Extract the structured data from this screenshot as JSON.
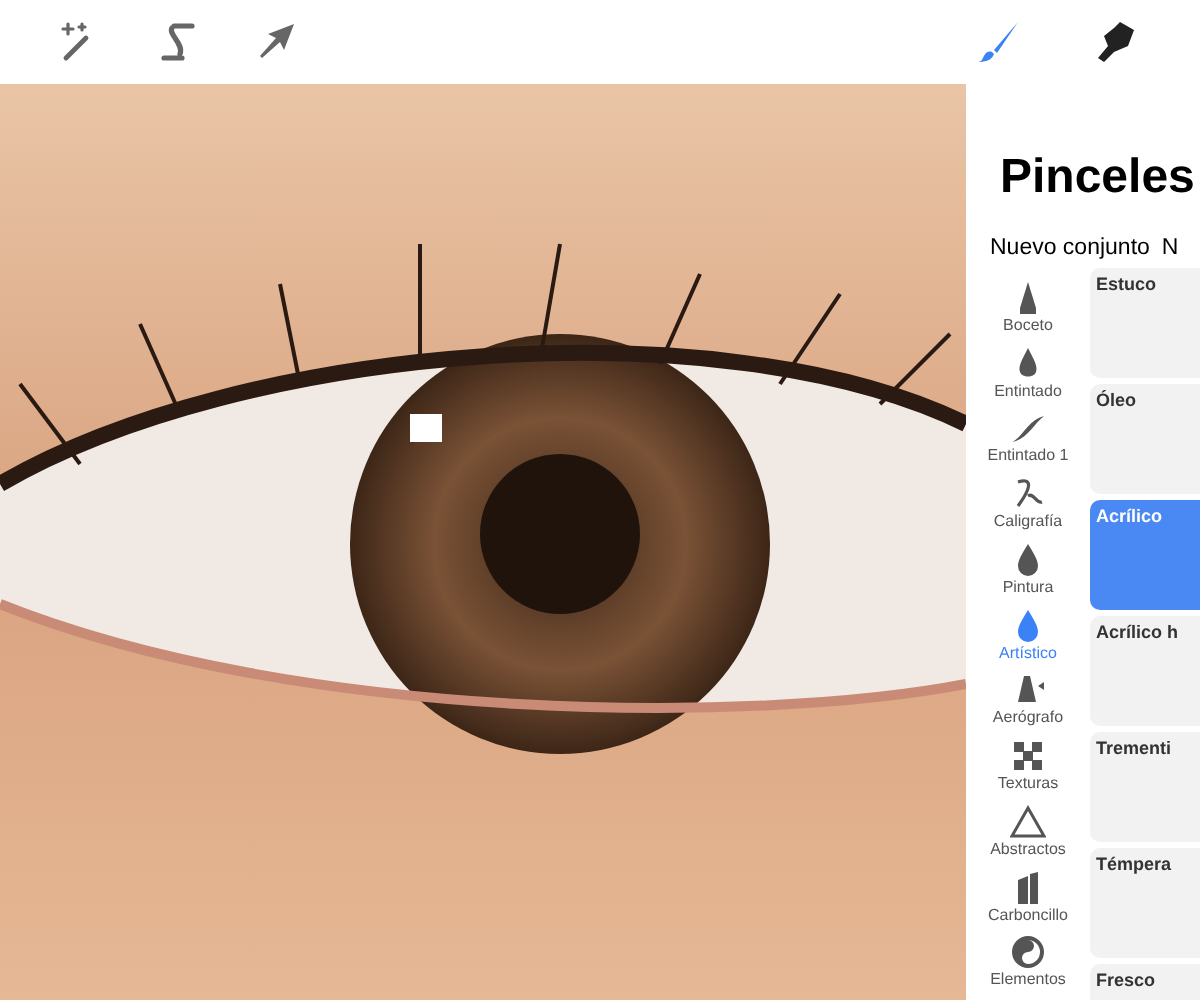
{
  "toolbar": {
    "tools": [
      {
        "kind": "wand",
        "selected": false
      },
      {
        "kind": "selection",
        "selected": false
      },
      {
        "kind": "transform",
        "selected": false
      }
    ],
    "right_tools": [
      {
        "kind": "brush",
        "selected": true
      },
      {
        "kind": "smudge",
        "selected": false
      }
    ]
  },
  "panel": {
    "title": "Pinceles",
    "actions": [
      "Nuevo conjunto",
      "N"
    ],
    "categories": [
      {
        "label": "Boceto",
        "kind": "cone",
        "selected": false
      },
      {
        "label": "Entintado",
        "kind": "nib",
        "selected": false
      },
      {
        "label": "Entintado 1",
        "kind": "stroke",
        "selected": false
      },
      {
        "label": "Caligrafía",
        "kind": "script",
        "selected": false
      },
      {
        "label": "Pintura",
        "kind": "drop",
        "selected": false
      },
      {
        "label": "Artístico",
        "kind": "drop",
        "selected": true
      },
      {
        "label": "Aerógrafo",
        "kind": "airbrush",
        "selected": false
      },
      {
        "label": "Texturas",
        "kind": "checker",
        "selected": false
      },
      {
        "label": "Abstractos",
        "kind": "triangle",
        "selected": false
      },
      {
        "label": "Carboncillo",
        "kind": "charcoal",
        "selected": false
      },
      {
        "label": "Elementos",
        "kind": "yinyang",
        "selected": false
      }
    ],
    "brushes": [
      {
        "name": "Estuco",
        "selected": false
      },
      {
        "name": "Óleo",
        "selected": false
      },
      {
        "name": "Acrílico",
        "selected": true
      },
      {
        "name": "Acrílico h",
        "selected": false
      },
      {
        "name": "Trementi",
        "selected": false
      },
      {
        "name": "Témpera",
        "selected": false
      },
      {
        "name": "Fresco",
        "selected": false
      }
    ]
  }
}
